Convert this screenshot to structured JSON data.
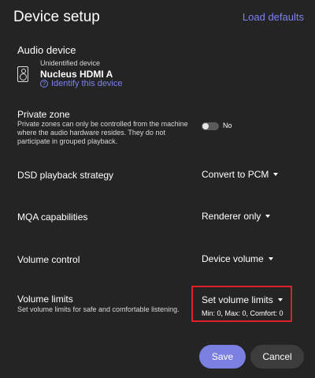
{
  "header": {
    "title": "Device setup",
    "load_defaults": "Load defaults"
  },
  "audio_device": {
    "label": "Audio device",
    "status": "Unidentified device",
    "name": "Nucleus HDMI A",
    "identify_link": "Identify this device"
  },
  "private_zone": {
    "label": "Private zone",
    "description_line1": "Private zones can only be controlled from the machine",
    "description_line2": "where the audio hardware resides. They do not",
    "description_line3": "participate in grouped playback.",
    "toggle_state": "No"
  },
  "dsd": {
    "label": "DSD playback strategy",
    "value": "Convert to PCM"
  },
  "mqa": {
    "label": "MQA capabilities",
    "value": "Renderer only"
  },
  "volume_control": {
    "label": "Volume control",
    "value": "Device volume"
  },
  "volume_limits": {
    "label": "Volume limits",
    "description": "Set volume limits for safe and comfortable listening.",
    "value": "Set volume limits",
    "summary": "Min: 0, Max: 0, Comfort: 0"
  },
  "footer": {
    "save": "Save",
    "cancel": "Cancel"
  },
  "colors": {
    "accent": "#7c82f0",
    "highlight": "#e0202a",
    "background": "#242424"
  }
}
